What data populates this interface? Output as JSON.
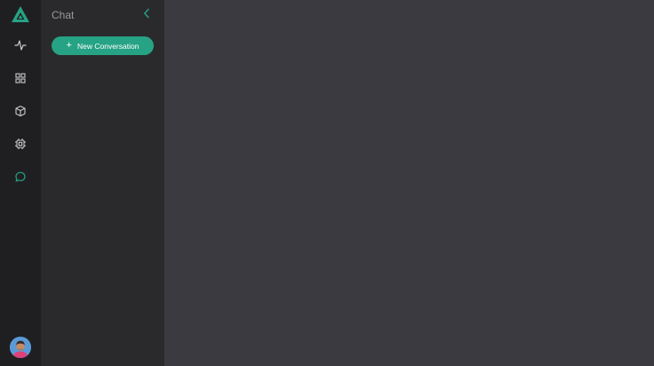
{
  "panel": {
    "title": "Chat",
    "new_conversation_label": "New Conversation"
  },
  "icons": {
    "logo": "triangle-logo-icon",
    "nav": [
      "activity-icon",
      "grid-icon",
      "cube-icon",
      "chip-icon",
      "chat-bubble-icon"
    ],
    "collapse": "chevron-left-icon",
    "add": "plus-icon"
  },
  "colors": {
    "accent": "#26a384",
    "rail_bg": "#1f1f21",
    "panel_bg": "#2a2a2c",
    "main_bg": "#3b3a40",
    "icon_default": "#c9c9cc",
    "title_text": "#9a9a9e"
  }
}
